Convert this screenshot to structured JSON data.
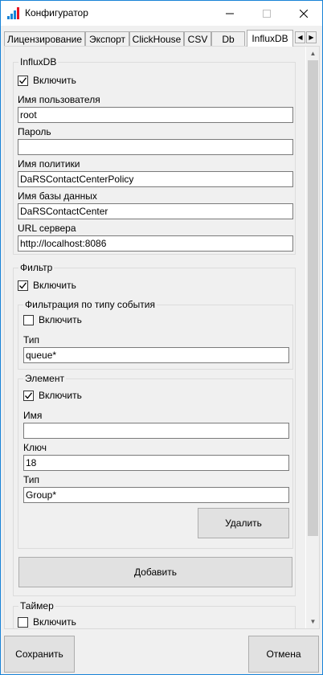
{
  "window": {
    "title": "Конфигуратор",
    "app_icon": "bar-chart-icon",
    "accent": "#1883d7"
  },
  "tabs": [
    {
      "label": "Лицензирование",
      "active": false
    },
    {
      "label": "Экспорт",
      "active": false
    },
    {
      "label": "ClickHouse",
      "active": false
    },
    {
      "label": "CSV",
      "active": false
    },
    {
      "label": "Db",
      "active": false
    },
    {
      "label": "InfluxDB",
      "active": true
    }
  ],
  "influxdb": {
    "legend": "InfluxDB",
    "enable": {
      "label": "Включить",
      "checked": true
    },
    "username": {
      "label": "Имя пользователя",
      "value": "root"
    },
    "password": {
      "label": "Пароль",
      "value": ""
    },
    "policy": {
      "label": "Имя политики",
      "value": "DaRSContactCenterPolicy"
    },
    "database": {
      "label": "Имя базы данных",
      "value": "DaRSContactCenter"
    },
    "url": {
      "label": "URL сервера",
      "value": "http://localhost:8086"
    }
  },
  "filter": {
    "legend": "Фильтр",
    "enable": {
      "label": "Включить",
      "checked": true
    },
    "event_type": {
      "legend": "Фильтрация по типу события",
      "enable": {
        "label": "Включить",
        "checked": false
      },
      "type": {
        "label": "Тип",
        "value": "queue*"
      }
    },
    "element": {
      "legend": "Элемент",
      "enable": {
        "label": "Включить",
        "checked": true
      },
      "name": {
        "label": "Имя",
        "value": ""
      },
      "key": {
        "label": "Ключ",
        "value": "18"
      },
      "type": {
        "label": "Тип",
        "value": "Group*"
      },
      "delete_label": "Удалить"
    },
    "add_label": "Добавить"
  },
  "timer": {
    "legend": "Таймер",
    "enable": {
      "label": "Включить",
      "checked": false
    }
  },
  "footer": {
    "save_label": "Сохранить",
    "cancel_label": "Отмена"
  }
}
